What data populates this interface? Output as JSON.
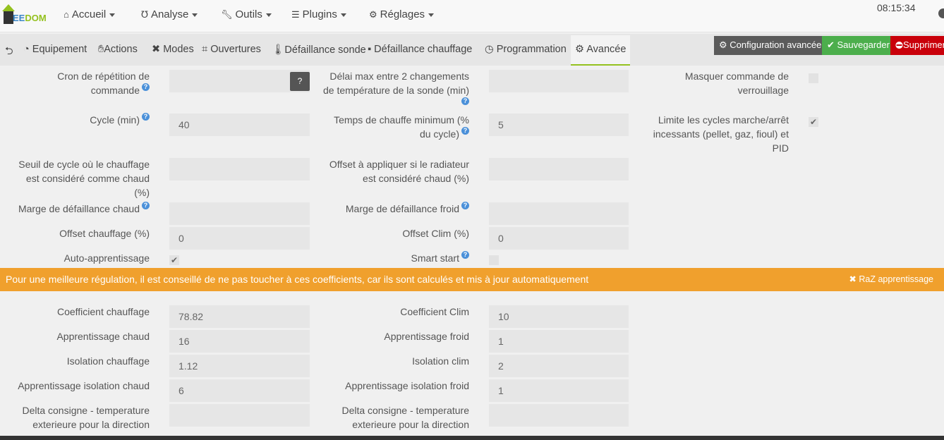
{
  "header": {
    "logo": "JEEDOM",
    "time": "08:15:34",
    "menu": [
      {
        "icon": "home-icon",
        "label": "Accueil"
      },
      {
        "icon": "stethoscope-icon",
        "label": "Analyse"
      },
      {
        "icon": "wrench-icon",
        "label": "Outils"
      },
      {
        "icon": "list-icon",
        "label": "Plugins"
      },
      {
        "icon": "gear-icon",
        "label": "Réglages"
      }
    ]
  },
  "tabs": [
    "Equipement",
    "Actions",
    "Modes",
    "Ouvertures",
    "Défaillance sonde",
    "Défaillance chauffage",
    "Programmation",
    "Avancée"
  ],
  "buttons": {
    "config": "Configuration avancée",
    "save": "Sauvegarder",
    "delete": "Supprimer"
  },
  "form1": {
    "cron_label": "Cron de répétition de commande",
    "cron_value": "",
    "delai_label": "Délai max entre 2 changements de température de la sonde (min)",
    "delai_value": "",
    "masquer_label": "Masquer commande de verrouillage",
    "masquer_checked": false,
    "cycle_label": "Cycle (min)",
    "cycle_value": "40",
    "temps_label": "Temps de chauffe minimum (% du cycle)",
    "temps_value": "5",
    "limite_label": "Limite les cycles marche/arrêt incessants (pellet, gaz, fioul) et PID",
    "limite_checked": true,
    "seuil_label": "Seuil de cycle où le chauffage est considéré comme chaud (%)",
    "seuil_value": "",
    "offsetrad_label": "Offset à appliquer si le radiateur est considéré chaud (%)",
    "offsetrad_value": "",
    "marge_chaud_label": "Marge de défaillance chaud",
    "marge_chaud_value": "",
    "marge_froid_label": "Marge de défaillance froid",
    "marge_froid_value": "",
    "offset_chauffage_label": "Offset chauffage (%)",
    "offset_chauffage_value": "0",
    "offset_clim_label": "Offset Clim (%)",
    "offset_clim_value": "0",
    "auto_label": "Auto-apprentissage",
    "auto_checked": true,
    "smart_label": "Smart start",
    "smart_checked": false
  },
  "banner": {
    "text": "Pour une meilleure régulation, il est conseillé de ne pas toucher à ces coefficients, car ils sont calculés et mis à jour automatiquement",
    "raz": "RaZ apprentissage"
  },
  "coef": [
    {
      "l1": "Coefficient chauffage",
      "v1": "78.82",
      "l2": "Coefficient Clim",
      "v2": "10"
    },
    {
      "l1": "Apprentissage chaud",
      "v1": "16",
      "l2": "Apprentissage froid",
      "v2": "1"
    },
    {
      "l1": "Isolation chauffage",
      "v1": "1.12",
      "l2": "Isolation clim",
      "v2": "2"
    },
    {
      "l1": "Apprentissage isolation chaud",
      "v1": "6",
      "l2": "Apprentissage isolation froid",
      "v2": "1"
    },
    {
      "l1": "Delta consigne - temperature exterieure pour la direction",
      "v1": "",
      "l2": "Delta consigne - temperature exterieure pour la direction",
      "v2": ""
    }
  ]
}
